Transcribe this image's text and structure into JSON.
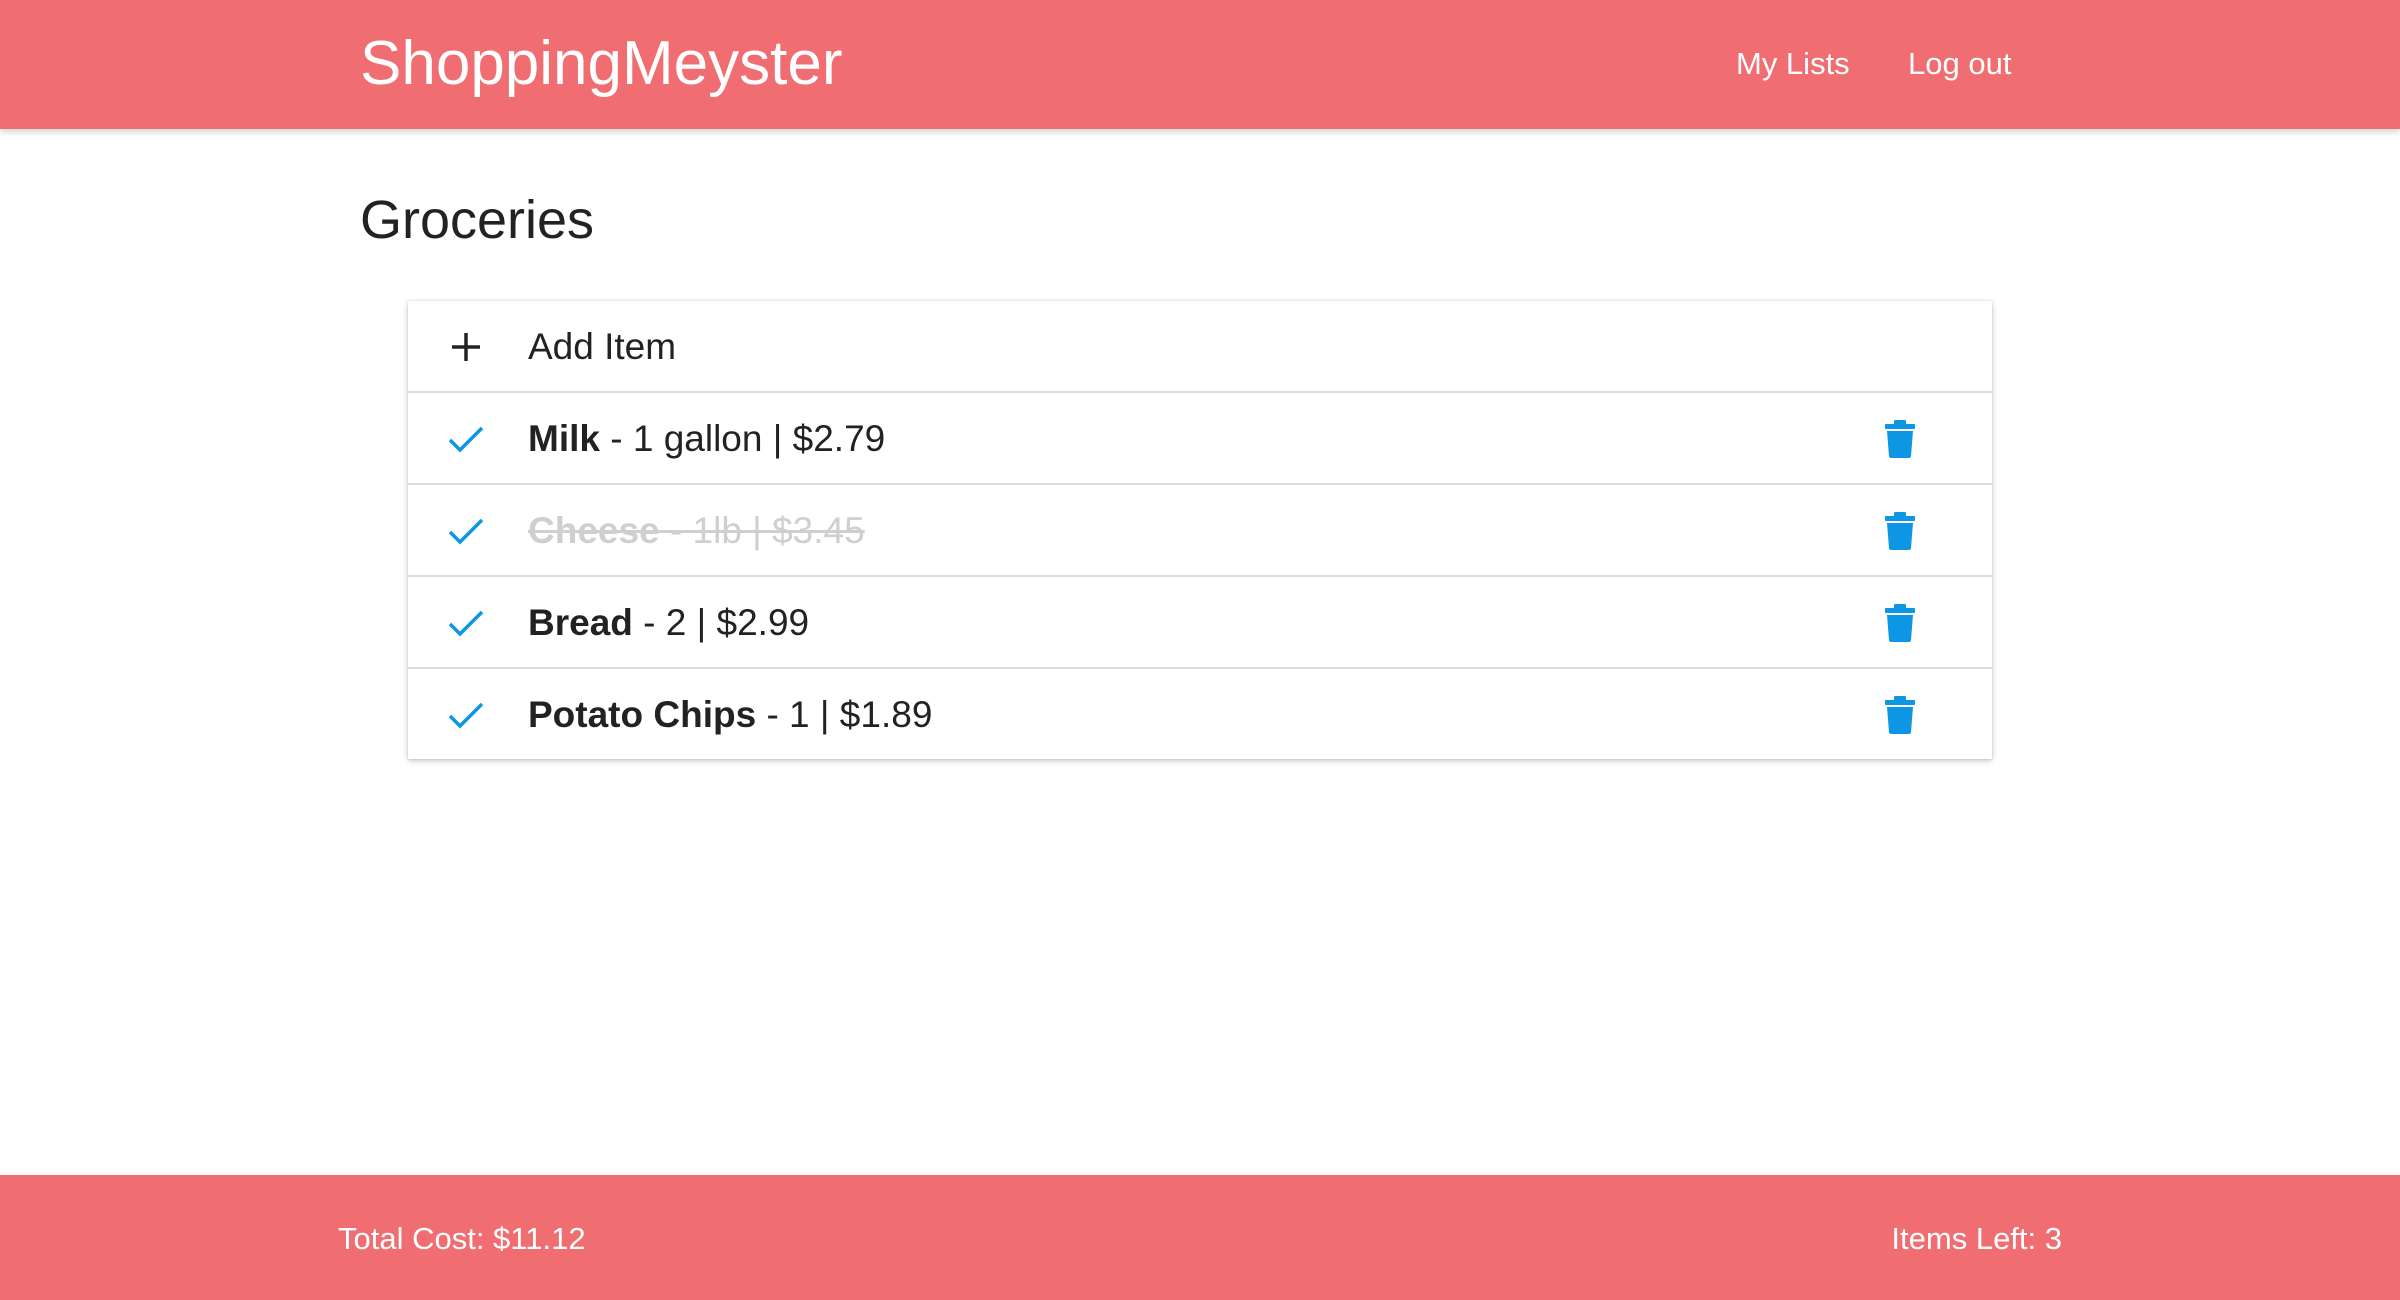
{
  "header": {
    "brand": "ShoppingMeyster",
    "nav": {
      "my_lists": "My Lists",
      "log_out": "Log out"
    }
  },
  "main": {
    "title": "Groceries",
    "add_item_label": "Add Item",
    "items": [
      {
        "name": "Milk",
        "detail": " - 1 gallon | $2.79",
        "checked": false
      },
      {
        "name": "Cheese",
        "detail": " - 1lb | $3.45",
        "checked": true
      },
      {
        "name": "Bread",
        "detail": " - 2 | $2.99",
        "checked": false
      },
      {
        "name": "Potato Chips",
        "detail": " - 1 | $1.89",
        "checked": false
      }
    ]
  },
  "footer": {
    "total_cost": "Total Cost: $11.12",
    "items_left": "Items Left: 3"
  },
  "colors": {
    "brand": "#F06D71",
    "accent": "#0C96E4",
    "done_text": "#cfcfcf"
  },
  "icons": {
    "add": "plus-icon",
    "check": "checkmark-icon",
    "delete": "trash-icon"
  }
}
